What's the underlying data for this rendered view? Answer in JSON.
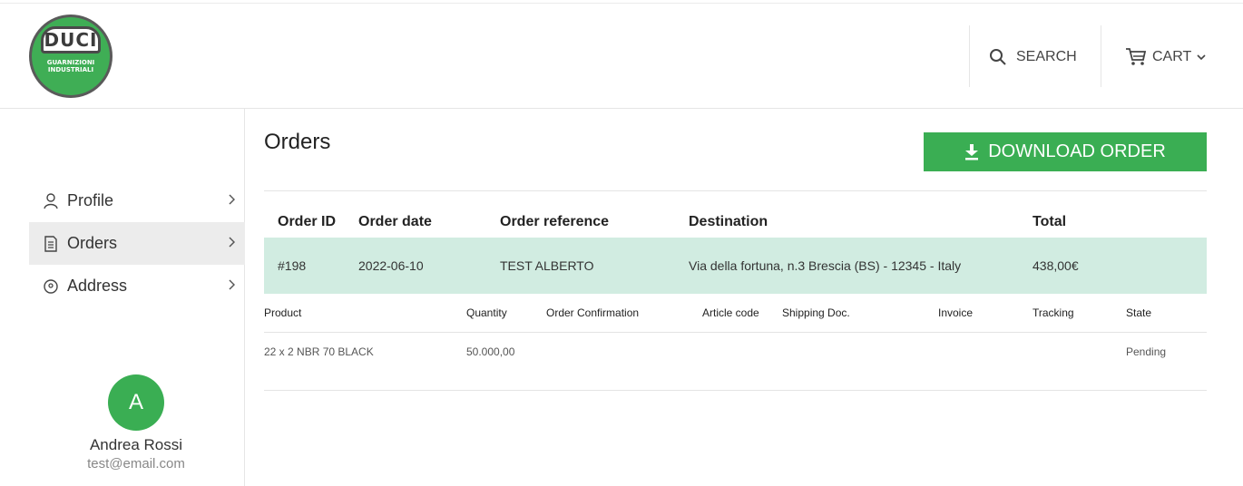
{
  "logo": {
    "brand": "DUCI",
    "line1": "GUARNIZIONI",
    "line2": "INDUSTRIALI"
  },
  "header": {
    "search_label": "SEARCH",
    "cart_label": "CART"
  },
  "sidebar": {
    "items": [
      {
        "label": "Profile",
        "icon": "user-icon",
        "active": false
      },
      {
        "label": "Orders",
        "icon": "document-icon",
        "active": true
      },
      {
        "label": "Address",
        "icon": "location-pin-icon",
        "active": false
      }
    ],
    "user": {
      "initial": "A",
      "name": "Andrea Rossi",
      "email": "test@email.com"
    }
  },
  "main": {
    "title": "Orders",
    "download_label": "DOWNLOAD ORDER",
    "order_columns": [
      "Order ID",
      "Order date",
      "Order reference",
      "Destination",
      "Total"
    ],
    "order": {
      "id": "#198",
      "date": "2022-06-10",
      "reference": "TEST ALBERTO",
      "destination": "Via della fortuna, n.3 Brescia (BS) - 12345 - Italy",
      "total": "438,00€"
    },
    "product_columns": [
      "Product",
      "Quantity",
      "Order Confirmation",
      "Article code",
      "Shipping Doc.",
      "Invoice",
      "Tracking",
      "State"
    ],
    "products": [
      {
        "product": "22 x 2 NBR 70 BLACK",
        "quantity": "50.000,00",
        "state": "Pending"
      }
    ]
  },
  "colors": {
    "accent": "#3aae53",
    "row_highlight": "#d1ece1"
  }
}
